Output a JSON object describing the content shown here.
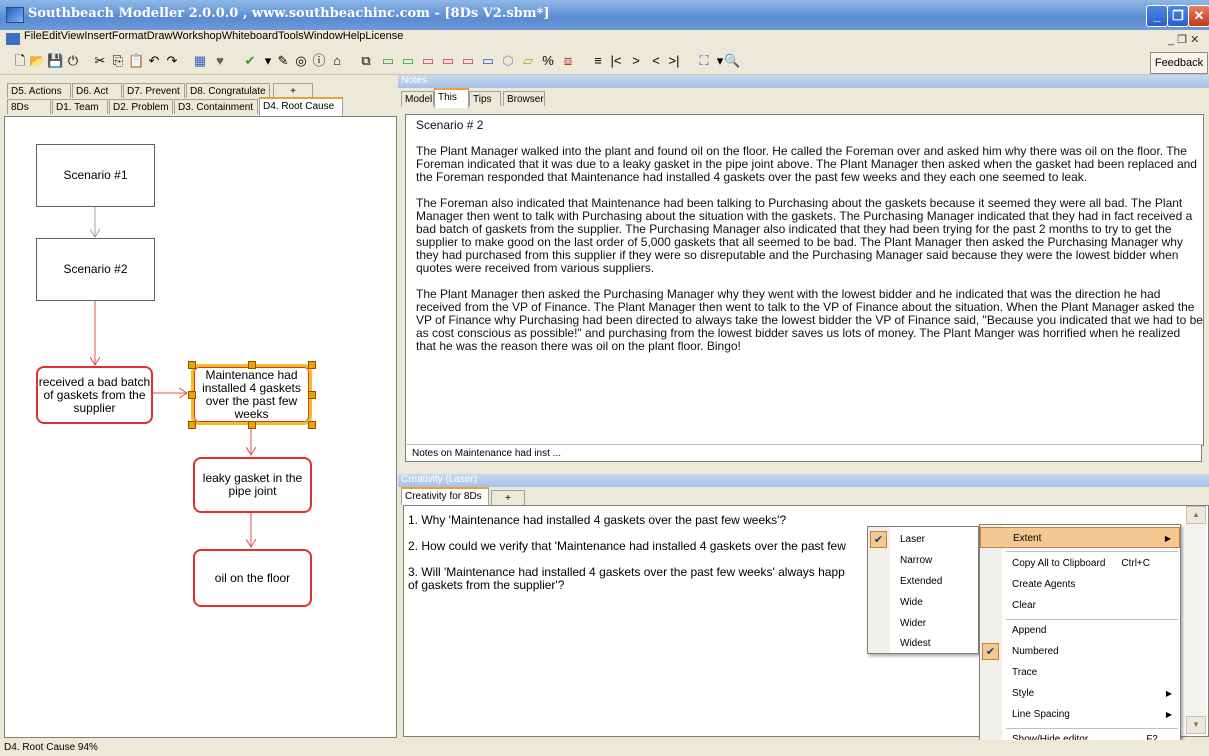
{
  "window": {
    "title": "Southbeach Modeller 2.0.0.0 , www.southbeachinc.com - [8Ds V2.sbm*]",
    "minimize": "_",
    "restore": "❐",
    "close": "✕"
  },
  "menubar": {
    "items": [
      "File",
      "Edit",
      "View",
      "Insert",
      "Format",
      "Draw",
      "Workshop",
      "Whiteboard",
      "Tools",
      "Window",
      "Help",
      "License"
    ],
    "mdi_controls": "_ ❐ ✕"
  },
  "toolbar": {
    "feedback_label": "Feedback"
  },
  "left_tabs": {
    "row1": [
      "D5. Actions",
      "D6. Act",
      "D7. Prevent",
      "D8. Congratulate",
      "+"
    ],
    "row2": [
      "8Ds",
      "D1. Team",
      "D2. Problem",
      "D3. Containment",
      "D4. Root Cause"
    ],
    "active": "D4. Root Cause"
  },
  "diagram": {
    "nodes": [
      {
        "id": "scenario1",
        "label": "Scenario #1"
      },
      {
        "id": "scenario2",
        "label": "Scenario #2"
      },
      {
        "id": "badbatch",
        "label": "received a bad batch of gaskets from the supplier"
      },
      {
        "id": "maintenance",
        "label": "Maintenance had installed 4 gaskets over the past few weeks"
      },
      {
        "id": "leaky",
        "label": "leaky gasket in the pipe joint"
      },
      {
        "id": "oil",
        "label": "oil on the floor"
      }
    ]
  },
  "notes": {
    "panel_title": "Notes",
    "tabs": [
      "Model",
      "This",
      "Tips",
      "Browser"
    ],
    "active_tab": "This",
    "heading": "Scenario # 2",
    "paragraphs": [
      "The Plant Manager walked into the plant and found oil on the floor. He called the Foreman over and asked him why there was oil on the floor. The Foreman indicated that it was due to a leaky gasket in the pipe joint above. The Plant Manager then asked when the gasket had been replaced and the Foreman responded that Maintenance had installed 4 gaskets over the past few weeks and they each one seemed to leak.",
      "The Foreman also indicated that Maintenance had been talking to Purchasing about the gaskets because it seemed they were all bad. The Plant Manager then went to talk with Purchasing about the situation with the gaskets. The Purchasing Manager indicated that they had in fact received a bad batch of gaskets from the supplier. The Purchasing Manager also indicated that they had been trying for the past 2 months to try to get the supplier to make good on the last order of 5,000 gaskets that all seemed to be bad. The Plant Manager then asked the Purchasing Manager why they had purchased from this supplier if they were so disreputable and the Purchasing Manager said because they were the lowest bidder when quotes were received from various suppliers.",
      "The Plant Manager then asked the Purchasing Manager why they went with the lowest bidder and he indicated that was the direction he had received from the VP of Finance. The Plant Manager then went to talk to the VP of Finance about the situation. When the Plant Manager asked the VP of Finance why Purchasing had been directed to always take the lowest bidder the VP of Finance said, \"Because you indicated that we had to be as cost conscious as possible!\" and purchasing from the lowest bidder saves us lots of money. The Plant Manger was horrified when he realized that he was the reason there was oil on the plant floor. Bingo!"
    ],
    "status": "Notes on Maintenance had inst ..."
  },
  "creativity": {
    "panel_title": "Creativity (Laser)",
    "tabs": [
      "Creativity for 8Ds",
      "+"
    ],
    "items": [
      "1.  Why 'Maintenance had installed 4 gaskets over the past few weeks'?",
      "2.  How could we verify that 'Maintenance had installed 4 gaskets over the past few",
      "3.  Will 'Maintenance had installed 4 gaskets over the past few weeks' always happ",
      "of gaskets from the supplier'?"
    ]
  },
  "extent_menu": {
    "items": [
      "Laser",
      "Narrow",
      "Extended",
      "Wide",
      "Wider",
      "Widest"
    ],
    "checked": "Laser"
  },
  "context_menu": {
    "extent": "Extent",
    "copy_all": "Copy All to Clipboard",
    "copy_all_shortcut": "Ctrl+C",
    "create_agents": "Create Agents",
    "clear": "Clear",
    "append": "Append",
    "numbered": "Numbered",
    "trace": "Trace",
    "style": "Style",
    "line_spacing": "Line Spacing",
    "show_hide": "Show/Hide editor",
    "show_hide_shortcut": "F2"
  },
  "statusbar": {
    "text": "D4. Root Cause  94%"
  },
  "colors": {
    "titlebar": "#6b9bd8",
    "node_border": "#e03030",
    "selection": "#f0c020",
    "menu_highlight": "#f4c890"
  }
}
